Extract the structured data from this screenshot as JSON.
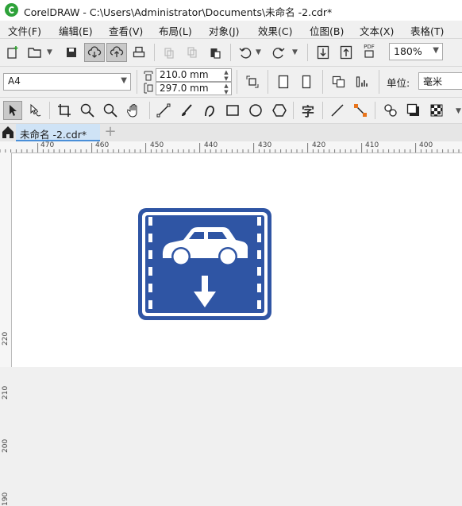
{
  "window": {
    "title": "CorelDRAW - C:\\Users\\Administrator\\Documents\\未命名 -2.cdr*"
  },
  "menu": [
    "文件(F)",
    "编辑(E)",
    "查看(V)",
    "布局(L)",
    "对象(J)",
    "效果(C)",
    "位图(B)",
    "文本(X)",
    "表格(T)"
  ],
  "standard_toolbar": {
    "zoom_value": "180%",
    "pdf_label": "PDF",
    "icons": [
      "new-document-icon",
      "open-icon",
      "save-icon",
      "cloud-download-icon",
      "cloud-upload-icon",
      "print-icon",
      "cut-icon",
      "copy-icon",
      "paste-icon",
      "undo-icon",
      "redo-icon",
      "import-icon",
      "export-icon",
      "publish-pdf-icon"
    ]
  },
  "property_bar": {
    "page_size": "A4",
    "width": "210.0 mm",
    "height": "297.0 mm",
    "units_label": "单位:",
    "units_value": "毫米"
  },
  "toolbox": {
    "text_tool_glyph": "字",
    "icons": [
      "pick-tool-icon",
      "shape-tool-icon",
      "crop-tool-icon",
      "zoom-tool-icon",
      "zoom-out-icon",
      "pan-tool-icon",
      "freehand-tool-icon",
      "artistic-media-icon",
      "bezier-curve-icon",
      "rectangle-tool-icon",
      "ellipse-tool-icon",
      "polygon-tool-icon",
      "text-tool-icon",
      "parallel-dimension-icon",
      "connector-tool-icon",
      "blend-tool-icon",
      "drop-shadow-icon",
      "transparency-tool-icon"
    ]
  },
  "tabs": {
    "document_tab": "未命名 -2.cdr*",
    "new_tab": "+"
  },
  "rulers": {
    "horizontal": [
      "470",
      "460",
      "450",
      "440",
      "430",
      "420",
      "410",
      "400"
    ],
    "vertical": [
      "220",
      "210",
      "200",
      "190"
    ]
  },
  "sign": {
    "bg": "#2f55a4",
    "fg": "#ffffff",
    "icons": [
      "car-icon",
      "down-arrow-icon"
    ]
  }
}
